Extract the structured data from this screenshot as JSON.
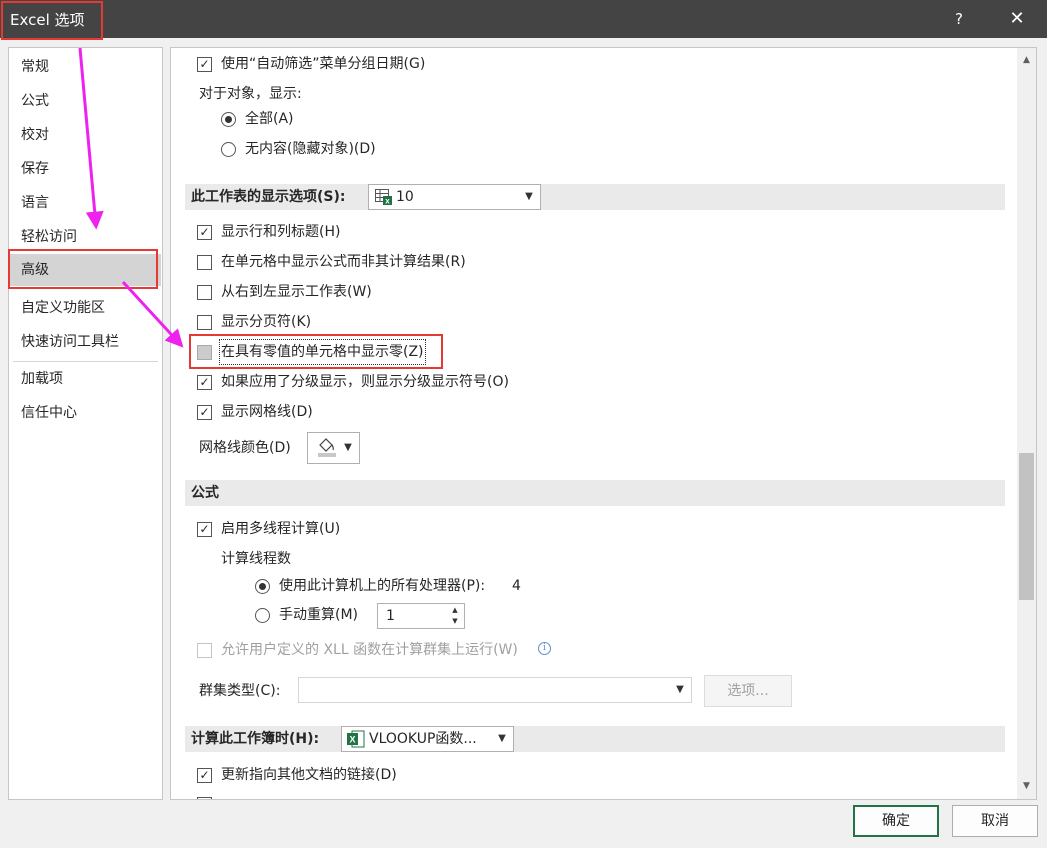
{
  "window": {
    "title": "Excel 选项",
    "help_label": "?",
    "close_label": "✕"
  },
  "nav": {
    "items": [
      {
        "label": "常规"
      },
      {
        "label": "公式"
      },
      {
        "label": "校对"
      },
      {
        "label": "保存"
      },
      {
        "label": "语言"
      },
      {
        "label": "轻松访问"
      },
      {
        "label": "高级",
        "selected": true
      },
      {
        "label": "自定义功能区"
      },
      {
        "label": "快速访问工具栏"
      },
      {
        "label": "加载项"
      },
      {
        "label": "信任中心"
      }
    ]
  },
  "content": {
    "filter_group_dates": {
      "label": "使用“自动筛选”菜单分组日期(G)",
      "checked": true
    },
    "objects_label": "对于对象，显示:",
    "objects_all": {
      "label": "全部(A)",
      "selected": true
    },
    "objects_none": {
      "label": "无内容(隐藏对象)(D)",
      "selected": false
    },
    "worksheet_section": {
      "title": "此工作表的显示选项(S):",
      "sheet_selector": "10"
    },
    "worksheet_options": [
      {
        "label": "显示行和列标题(H)",
        "checked": true
      },
      {
        "label": "在单元格中显示公式而非其计算结果(R)",
        "checked": false
      },
      {
        "label": "从右到左显示工作表(W)",
        "checked": false
      },
      {
        "label": "显示分页符(K)",
        "checked": false
      },
      {
        "label": "在具有零值的单元格中显示零(Z)",
        "checked": false
      },
      {
        "label": "如果应用了分级显示，则显示分级显示符号(O)",
        "checked": true
      },
      {
        "label": "显示网格线(D)",
        "checked": true
      }
    ],
    "gridline_color_label": "网格线颜色(D)",
    "formula_section": {
      "title": "公式"
    },
    "multithread": {
      "label": "启用多线程计算(U)",
      "checked": true
    },
    "thread_count_label": "计算线程数",
    "use_all_processors": {
      "label": "使用此计算机上的所有处理器(P):",
      "value": "4",
      "selected": true
    },
    "manual_threads": {
      "label": "手动重算(M)",
      "value": "1",
      "selected": false
    },
    "xll_cluster": {
      "label": "允许用户定义的 XLL 函数在计算群集上运行(W)",
      "checked": false,
      "enabled": false
    },
    "info_glyph": "i",
    "cluster_type_label": "群集类型(C):",
    "cluster_type_value": "",
    "options_button": "选项...",
    "workbook_section": {
      "title": "计算此工作簿时(H):",
      "workbook_selector": "VLOOKUP函数..."
    },
    "update_links": {
      "label": "更新指向其他文档的链接(D)",
      "checked": true
    }
  },
  "scrollbar": {
    "up": "▲",
    "down": "▼"
  },
  "footer": {
    "ok_label": "确定",
    "cancel_label": "取消"
  },
  "colors": {
    "titlebar": "#444444",
    "annotation_red": "#e53935",
    "annotation_magenta": "#ee22ee",
    "excel_green": "#217346",
    "selected_nav": "#d4d4d4"
  }
}
